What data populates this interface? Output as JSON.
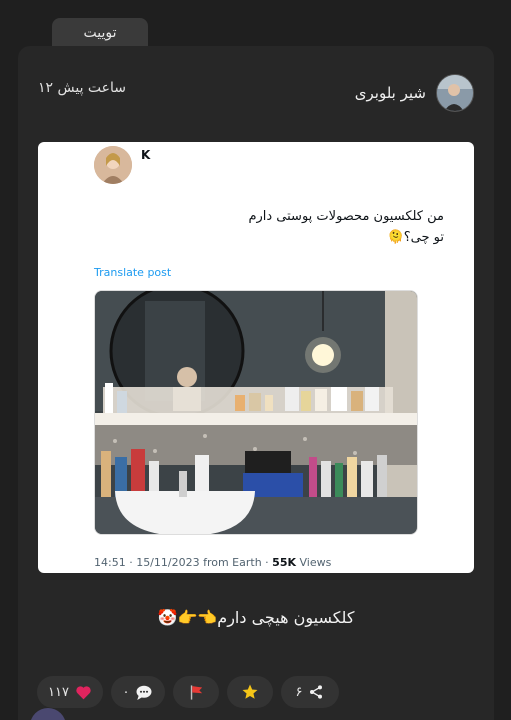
{
  "tab": {
    "label": "توییت"
  },
  "post": {
    "author_name": "شیر بلوبری",
    "time": "۱۲ ساعت پیش",
    "caption": "کلکسیون هیچی دارم👈👉🤡"
  },
  "embed": {
    "name": "K",
    "text_line1": "من کلکسیون محصولات پوستی دارم",
    "text_line2": "تو چی؟🫠",
    "translate": "Translate post",
    "meta_time": "14:51 · 15/11/2023 from Earth · ",
    "views": "55K",
    "views_label": " Views"
  },
  "actions": {
    "likes": "۱۱۷",
    "comments": "۰",
    "shares": "۶"
  },
  "colors": {
    "background": "#1f1f1f",
    "card": "#272727",
    "pill": "#333333",
    "heart": "#e0245e",
    "flag": "#e53935",
    "star": "#f5c518",
    "link": "#1d9bf0"
  },
  "icons": [
    "heart-icon",
    "comment-icon",
    "flag-icon",
    "star-icon",
    "share-icon"
  ]
}
